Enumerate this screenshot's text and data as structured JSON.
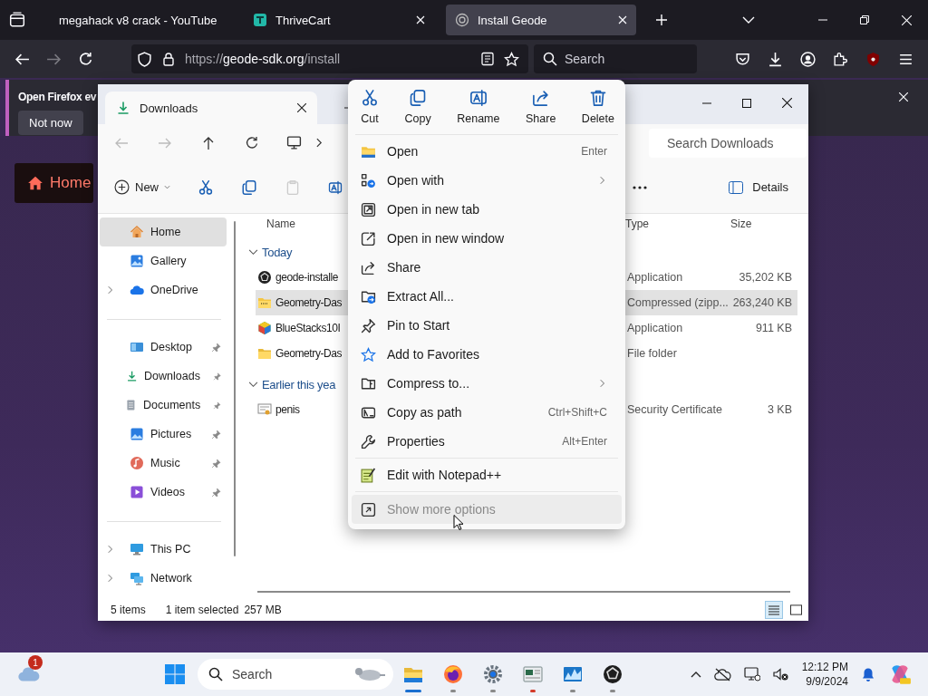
{
  "browser": {
    "tabs": [
      {
        "title": "megahack v8 crack - YouTube",
        "selected": false
      },
      {
        "title": "ThriveCart",
        "selected": false
      },
      {
        "title": "Install Geode",
        "selected": true
      }
    ],
    "url": {
      "scheme": "https://",
      "host": "geode-sdk.org",
      "path": "/install"
    },
    "search": {
      "placeholder": "Search"
    }
  },
  "notification": {
    "text": "Open Firefox ev",
    "button": "Not now"
  },
  "page": {
    "home_button": "Home"
  },
  "explorer": {
    "tab": "Downloads",
    "search": {
      "placeholder": "Search Downloads"
    },
    "commands": {
      "new": "New",
      "details": "Details"
    },
    "sidebar": [
      [
        {
          "label": "Home",
          "selected": true,
          "pinned": false,
          "expandable": false
        },
        {
          "label": "Gallery",
          "selected": false,
          "pinned": false,
          "expandable": false
        },
        {
          "label": "OneDrive",
          "selected": false,
          "pinned": false,
          "expandable": true
        }
      ],
      [
        {
          "label": "Desktop",
          "selected": false,
          "pinned": true,
          "expandable": false
        },
        {
          "label": "Downloads",
          "selected": false,
          "pinned": true,
          "expandable": false
        },
        {
          "label": "Documents",
          "selected": false,
          "pinned": true,
          "expandable": false
        },
        {
          "label": "Pictures",
          "selected": false,
          "pinned": true,
          "expandable": false
        },
        {
          "label": "Music",
          "selected": false,
          "pinned": true,
          "expandable": false
        },
        {
          "label": "Videos",
          "selected": false,
          "pinned": true,
          "expandable": false
        }
      ],
      [
        {
          "label": "This PC",
          "selected": false,
          "pinned": false,
          "expandable": true
        },
        {
          "label": "Network",
          "selected": false,
          "pinned": false,
          "expandable": true
        }
      ]
    ],
    "columns": {
      "name": "Name",
      "type": "Type",
      "size": "Size"
    },
    "groups": [
      {
        "label": "Today",
        "expanded": true,
        "files": [
          {
            "name": "geode-installe",
            "type": "Application",
            "size": "35,202 KB",
            "selected": false
          },
          {
            "name": "Geometry-Das",
            "type": "Compressed (zipp...",
            "size": "263,240 KB",
            "selected": true
          },
          {
            "name": "BlueStacks10I",
            "type": "Application",
            "size": "911 KB",
            "selected": false
          },
          {
            "name": "Geometry-Das",
            "type": "File folder",
            "selected": false
          }
        ]
      },
      {
        "label": "Earlier this yea",
        "expanded": true,
        "files": [
          {
            "name": "penis",
            "type": "Security Certificate",
            "size": "3 KB",
            "selected": false
          }
        ]
      }
    ],
    "status": {
      "count": "5 items",
      "selection": "1 item selected",
      "size": "257 MB"
    },
    "views": [
      {
        "selected": true
      },
      {
        "selected": false
      }
    ]
  },
  "context_menu": {
    "actions": [
      "Cut",
      "Copy",
      "Rename",
      "Share",
      "Delete"
    ],
    "items": [
      {
        "label": "Open",
        "shortcut": "Enter",
        "submenu": false
      },
      {
        "label": "Open with",
        "submenu": true
      },
      {
        "label": "Open in new tab",
        "submenu": false
      },
      {
        "label": "Open in new window",
        "submenu": false
      },
      {
        "label": "Share",
        "submenu": false
      },
      {
        "label": "Extract All...",
        "submenu": false
      },
      {
        "label": "Pin to Start",
        "submenu": false
      },
      {
        "label": "Add to Favorites",
        "submenu": false
      },
      {
        "label": "Compress to...",
        "submenu": true
      },
      {
        "label": "Copy as path",
        "shortcut": "Ctrl+Shift+C",
        "submenu": false
      },
      {
        "label": "Properties",
        "shortcut": "Alt+Enter",
        "submenu": false
      }
    ],
    "extra": [
      {
        "label": "Edit with Notepad++"
      }
    ],
    "more": {
      "label": "Show more options",
      "hovered": true
    }
  },
  "taskbar": {
    "weather_badge": "1",
    "search": {
      "placeholder": "Search"
    },
    "apps": [
      {
        "active": true,
        "alert": false
      },
      {
        "active": false,
        "alert": false
      },
      {
        "active": false,
        "alert": false
      },
      {
        "active": false,
        "alert": true
      },
      {
        "active": false,
        "alert": false
      },
      {
        "active": false,
        "alert": false
      }
    ],
    "time": "12:12 PM",
    "date": "9/9/2024"
  }
}
